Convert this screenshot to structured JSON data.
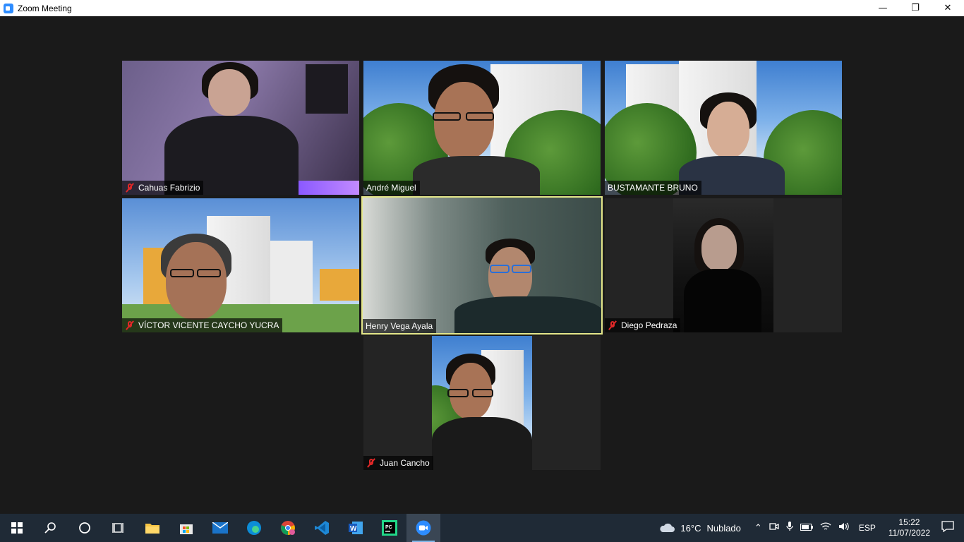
{
  "window": {
    "title": "Zoom Meeting",
    "minimize": "—",
    "restore": "❐",
    "close": "✕"
  },
  "participants": [
    {
      "name": "Cahuas  Fabrizio",
      "muted": true
    },
    {
      "name": "André Miguel",
      "muted": false
    },
    {
      "name": "BUSTAMANTE BRUNO",
      "muted": false
    },
    {
      "name": "VÍCTOR VICENTE CAYCHO YUCRA",
      "muted": true
    },
    {
      "name": "Henry Vega Ayala",
      "muted": false,
      "active_speaker": true
    },
    {
      "name": "Diego Pedraza",
      "muted": true
    },
    {
      "name": "Juan Cancho",
      "muted": true
    }
  ],
  "taskbar": {
    "apps": [
      "start-icon",
      "search-icon",
      "cortana-icon",
      "task-view-icon",
      "file-explorer-icon",
      "microsoft-store-icon",
      "mail-icon",
      "edge-icon",
      "chrome-icon",
      "vscode-icon",
      "word-icon",
      "pycharm-icon",
      "zoom-icon"
    ],
    "weather_temp": "16°C",
    "weather_desc": "Nublado",
    "language": "ESP",
    "time": "15:22",
    "date": "11/07/2022"
  },
  "colors": {
    "accent": "#2d8cff",
    "active_speaker_border": "#e4e78a",
    "muted_icon": "#e02828",
    "taskbar": "#1f2a36"
  }
}
